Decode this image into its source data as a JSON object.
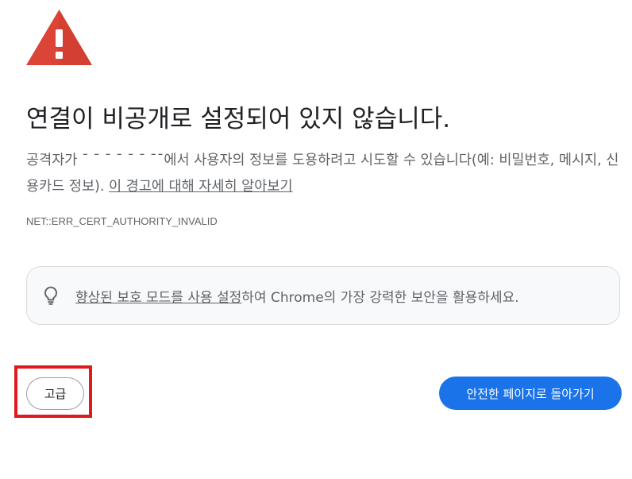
{
  "page": {
    "heading": "연결이 비공개로 설정되어 있지 않습니다.",
    "description": {
      "prefix": "공격자가 ",
      "host": "ˉ ˉ ˉ ˉ  ˉ ˉ ˉˉ",
      "middle": "에서 사용자의 정보를 도용하려고 시도할 수 있습니다(예: 비밀번호, 메시지, 신용카드 정보). ",
      "link": "이 경고에 대해 자세히 알아보기"
    },
    "error_code": "NET::ERR_CERT_AUTHORITY_INVALID",
    "promo": {
      "link": "향상된 보호 모드를 사용 설정",
      "text": "하여 Chrome의 가장 강력한 보안을 활용하세요."
    },
    "buttons": {
      "advanced": "고급",
      "back_to_safety": "안전한 페이지로 돌아가기"
    }
  },
  "colors": {
    "warning_red": "#db4437",
    "primary_blue": "#1a73e8",
    "highlight_red": "#e0191f",
    "secondary_text": "#5f6368"
  },
  "icons": {
    "warning": "warning-triangle-icon",
    "tip": "lightbulb-icon"
  }
}
